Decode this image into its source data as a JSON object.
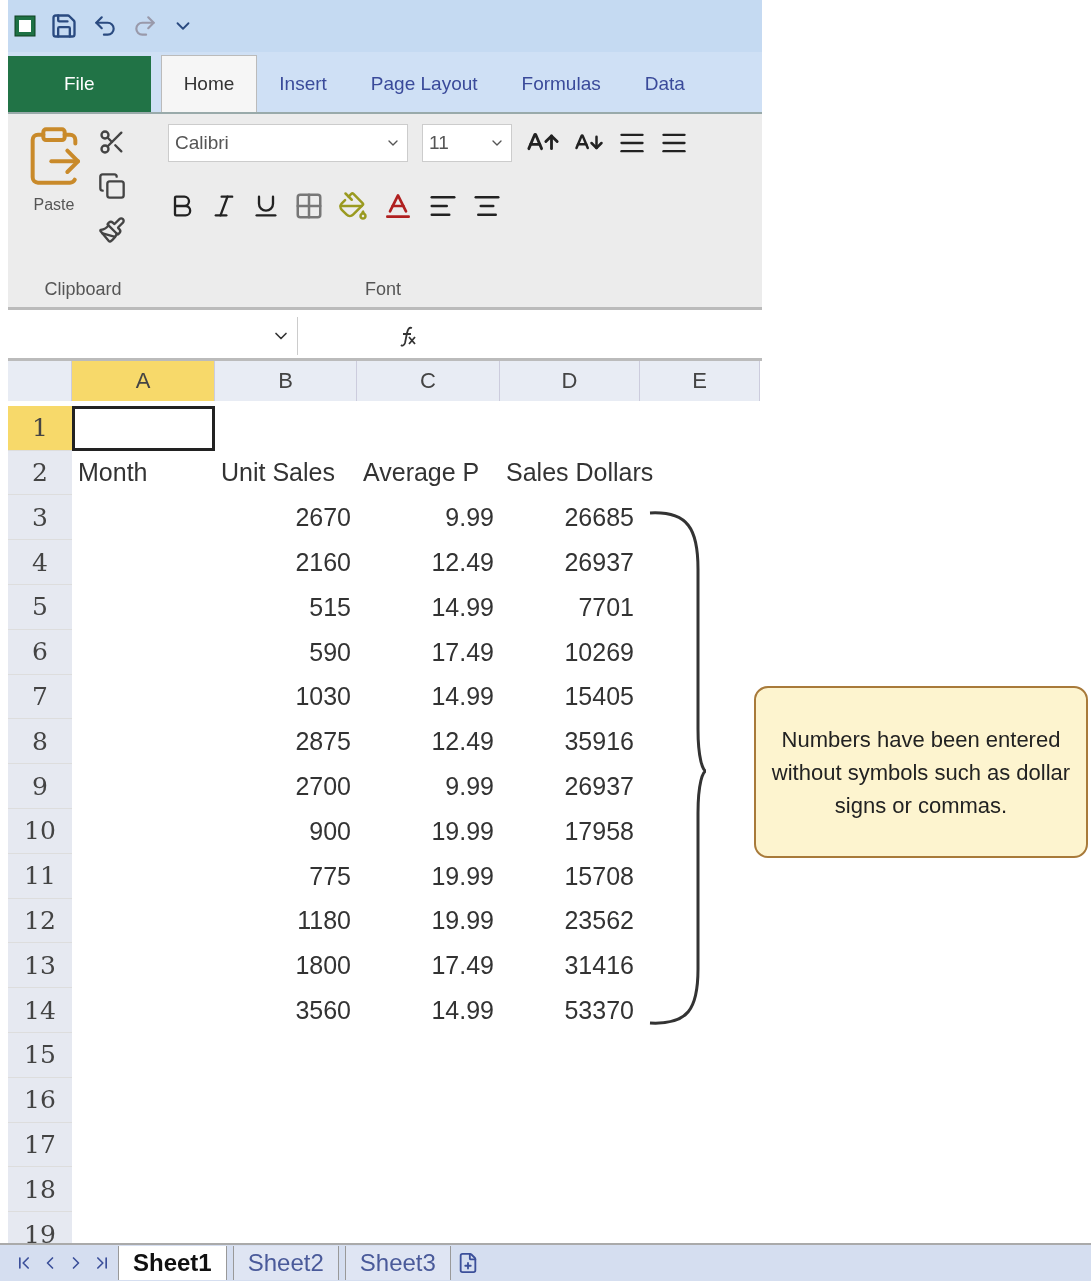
{
  "tabs": [
    {
      "label": "File",
      "kind": "file",
      "selected": false
    },
    {
      "label": "Home",
      "kind": "tab",
      "selected": true
    },
    {
      "label": "Insert",
      "kind": "tab",
      "selected": false
    },
    {
      "label": "Page Layout",
      "kind": "tab",
      "selected": false
    },
    {
      "label": "Formulas",
      "kind": "tab",
      "selected": false
    },
    {
      "label": "Data",
      "kind": "tab",
      "selected": false
    }
  ],
  "ribbon": {
    "paste_label": "Paste",
    "font_name": "Calibri",
    "font_size": "11",
    "groups": [
      "Clipboard",
      "Font"
    ]
  },
  "columns": [
    {
      "label": "A",
      "selected": true
    },
    {
      "label": "B",
      "selected": false
    },
    {
      "label": "C",
      "selected": false
    },
    {
      "label": "D",
      "selected": false
    },
    {
      "label": "E",
      "selected": false
    }
  ],
  "rows": [
    {
      "number": "1",
      "selected": true
    },
    {
      "number": "2",
      "selected": false,
      "cells": {
        "a": "Month",
        "b": "Unit Sales",
        "c": "Average P",
        "d": "Sales Dollars"
      }
    },
    {
      "number": "3",
      "selected": false,
      "cells": {
        "b": "2670",
        "c": "9.99",
        "d": "26685"
      }
    },
    {
      "number": "4",
      "selected": false,
      "cells": {
        "b": "2160",
        "c": "12.49",
        "d": "26937"
      }
    },
    {
      "number": "5",
      "selected": false,
      "cells": {
        "b": "515",
        "c": "14.99",
        "d": "7701"
      }
    },
    {
      "number": "6",
      "selected": false,
      "cells": {
        "b": "590",
        "c": "17.49",
        "d": "10269"
      }
    },
    {
      "number": "7",
      "selected": false,
      "cells": {
        "b": "1030",
        "c": "14.99",
        "d": "15405"
      }
    },
    {
      "number": "8",
      "selected": false,
      "cells": {
        "b": "2875",
        "c": "12.49",
        "d": "35916"
      }
    },
    {
      "number": "9",
      "selected": false,
      "cells": {
        "b": "2700",
        "c": "9.99",
        "d": "26937"
      }
    },
    {
      "number": "10",
      "selected": false,
      "cells": {
        "b": "900",
        "c": "19.99",
        "d": "17958"
      }
    },
    {
      "number": "11",
      "selected": false,
      "cells": {
        "b": "775",
        "c": "19.99",
        "d": "15708"
      }
    },
    {
      "number": "12",
      "selected": false,
      "cells": {
        "b": "1180",
        "c": "19.99",
        "d": "23562"
      }
    },
    {
      "number": "13",
      "selected": false,
      "cells": {
        "b": "1800",
        "c": "17.49",
        "d": "31416"
      }
    },
    {
      "number": "14",
      "selected": false,
      "cells": {
        "b": "3560",
        "c": "14.99",
        "d": "53370"
      }
    },
    {
      "number": "15",
      "selected": false
    },
    {
      "number": "16",
      "selected": false
    },
    {
      "number": "17",
      "selected": false
    },
    {
      "number": "18",
      "selected": false
    },
    {
      "number": "19",
      "selected": false
    }
  ],
  "callout": {
    "text": "Numbers have been entered without symbols such as dollar signs or commas."
  },
  "sheet_tabs": [
    {
      "label": "Sheet1",
      "selected": true
    },
    {
      "label": "Sheet2",
      "selected": false
    },
    {
      "label": "Sheet3",
      "selected": false
    }
  ]
}
